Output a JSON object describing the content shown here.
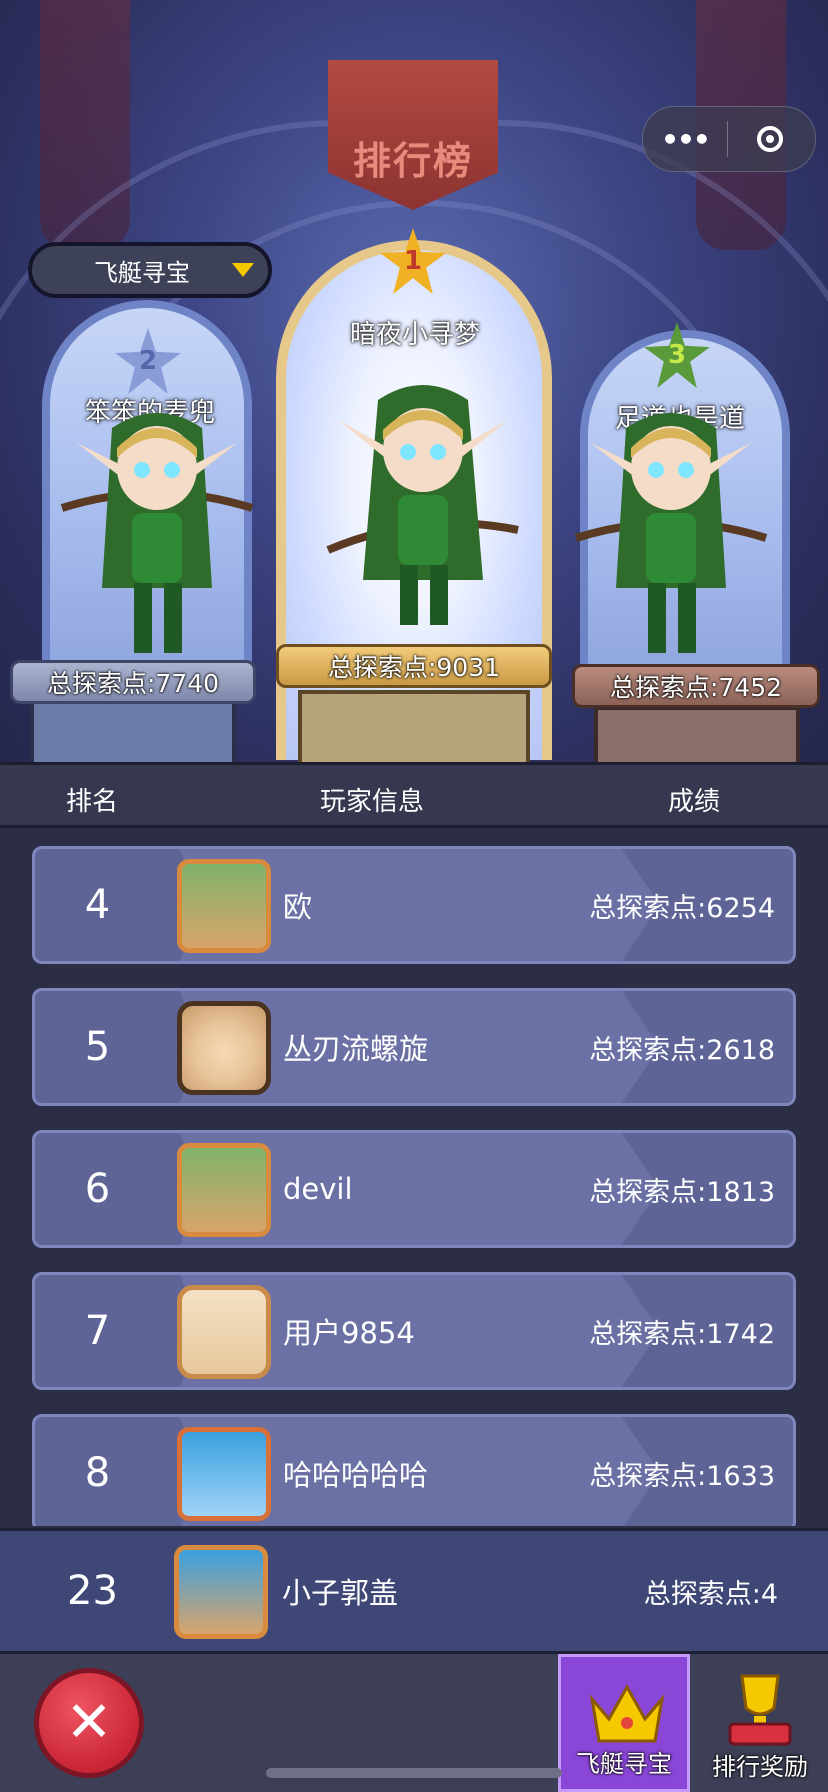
{
  "header": {
    "title": "排行榜",
    "capsule_more": "•••"
  },
  "dropdown": {
    "label": "飞艇寻宝"
  },
  "podium": [
    {
      "rank": "1",
      "name": "暗夜小寻梦",
      "score": "总探索点:9031"
    },
    {
      "rank": "2",
      "name": "笨笨的麦兜",
      "score": "总探索点:7740"
    },
    {
      "rank": "3",
      "name": "足道也是道",
      "score": "总探索点:7452"
    }
  ],
  "columns": {
    "rank": "排名",
    "player": "玩家信息",
    "score": "成绩"
  },
  "rows": [
    {
      "rank": "4",
      "name": "欧",
      "score": "总探索点:6254",
      "avatar": "elf-archer-avatar"
    },
    {
      "rank": "5",
      "name": "丛刃流螺旋",
      "score": "总探索点:2618",
      "avatar": "monk-avatar"
    },
    {
      "rank": "6",
      "name": "devil",
      "score": "总探索点:1813",
      "avatar": "elf-archer-avatar"
    },
    {
      "rank": "7",
      "name": "用户9854",
      "score": "总探索点:1742",
      "avatar": "blonde-girl-avatar"
    },
    {
      "rank": "8",
      "name": "哈哈哈哈哈",
      "score": "总探索点:1633",
      "avatar": "duck-avatar"
    }
  ],
  "self": {
    "rank": "23",
    "name": "小子郭盖",
    "score": "总探索点:4"
  },
  "bottom": {
    "close_symbol": "✕",
    "tabs": [
      {
        "label": "飞艇寻宝",
        "icon": "crown-icon",
        "active": true
      },
      {
        "label": "排行奖励",
        "icon": "trophy-icon",
        "active": false
      }
    ]
  },
  "colors": {
    "list_row": "#5f6497",
    "gold": "#f5c800",
    "active_tab": "#8a46d6",
    "close": "#d9313f"
  }
}
